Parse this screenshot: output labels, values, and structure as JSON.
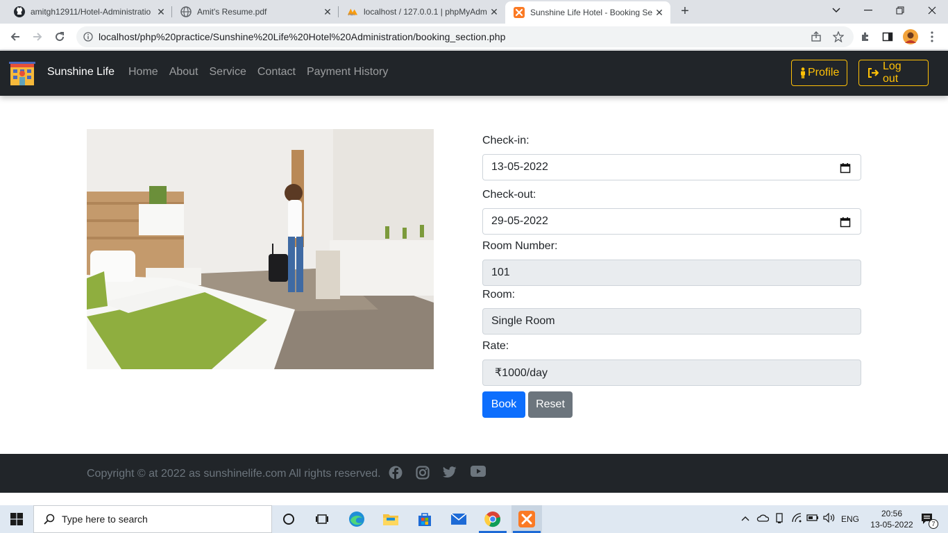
{
  "browser": {
    "tabs": [
      {
        "title": "amitgh12911/Hotel-Administratio",
        "favicon": "github-icon"
      },
      {
        "title": "Amit's Resume.pdf",
        "favicon": "globe-icon"
      },
      {
        "title": "localhost / 127.0.0.1 | phpMyAdm",
        "favicon": "phpmyadmin-icon"
      },
      {
        "title": "Sunshine Life Hotel - Booking Se",
        "favicon": "xampp-icon",
        "active": true
      }
    ],
    "url": "localhost/php%20practice/Sunshine%20Life%20Hotel%20Administration/booking_section.php"
  },
  "navbar": {
    "brand": "Sunshine Life",
    "links": [
      "Home",
      "About",
      "Service",
      "Contact",
      "Payment History"
    ],
    "profile_label": "Profile",
    "logout_label": "Log out"
  },
  "form": {
    "checkin_label": "Check-in:",
    "checkin_value": "13-05-2022",
    "checkout_label": "Check-out:",
    "checkout_value": "29-05-2022",
    "room_number_label": "Room Number:",
    "room_number_value": "101",
    "room_label": "Room:",
    "room_value": "Single Room",
    "rate_label": "Rate:",
    "rate_value": "₹1000/day",
    "book_label": "Book",
    "reset_label": "Reset"
  },
  "footer": {
    "copyright": "Copyright © at 2022 as sunshinelife.com All rights reserved."
  },
  "taskbar": {
    "search_placeholder": "Type here to search",
    "language": "ENG",
    "time": "20:56",
    "date": "13-05-2022",
    "notification_count": "7"
  },
  "colors": {
    "navbar_bg": "#212529",
    "accent_warning": "#ffc107",
    "primary": "#0d6efd",
    "secondary": "#6c757d"
  }
}
